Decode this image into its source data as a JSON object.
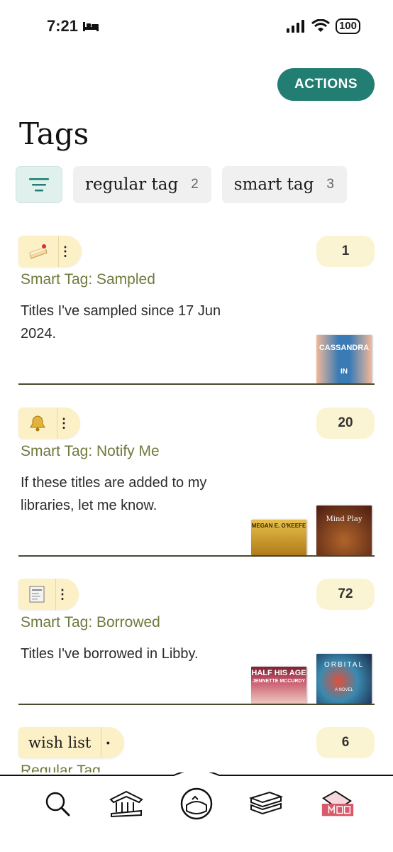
{
  "status_bar": {
    "time": "7:21",
    "battery": "100"
  },
  "header": {
    "actions_label": "ACTIONS",
    "title": "Tags"
  },
  "filters": {
    "chips": [
      {
        "label": "regular tag",
        "count": "2"
      },
      {
        "label": "smart tag",
        "count": "3"
      }
    ]
  },
  "tags": [
    {
      "icon": "cake-icon",
      "name": "",
      "count": "1",
      "type": "Smart Tag: Sampled",
      "description": "Titles I've sampled since 17 Jun 2024.",
      "covers": [
        {
          "text": "CASSANDRA",
          "subtext": "IN",
          "color": "#3a7bb5"
        }
      ]
    },
    {
      "icon": "bell-icon",
      "name": "",
      "count": "20",
      "type": "Smart Tag: Notify Me",
      "description": "If these titles are added to my libraries, let me know.",
      "covers": [
        {
          "text": "MEGAN E. O'KEEFE",
          "subtext": "",
          "color": "#c89a2a"
        },
        {
          "text": "Mind Play",
          "subtext": "",
          "color": "#5a2a1c"
        }
      ]
    },
    {
      "icon": "receipt-icon",
      "name": "",
      "count": "72",
      "type": "Smart Tag: Borrowed",
      "description": "Titles I've borrowed in Libby.",
      "covers": [
        {
          "text": "HALF HIS AGE",
          "subtext": "JENNETTE MCCURDY",
          "color": "#c95a6e"
        },
        {
          "text": "ORBITAL",
          "subtext": "A NOVEL",
          "color": "#2a4a6e"
        }
      ]
    },
    {
      "icon": "",
      "name": "wish list",
      "count": "6",
      "type": "Regular Tag",
      "description": "",
      "covers": []
    }
  ],
  "bottom_nav": {
    "items": [
      "search-icon",
      "library-icon",
      "timeline-icon",
      "shelf-icon",
      "tags-icon"
    ]
  },
  "colors": {
    "accent": "#227d73",
    "tag_bg": "#fbf0c6",
    "tag_type": "#6f7a3d"
  }
}
